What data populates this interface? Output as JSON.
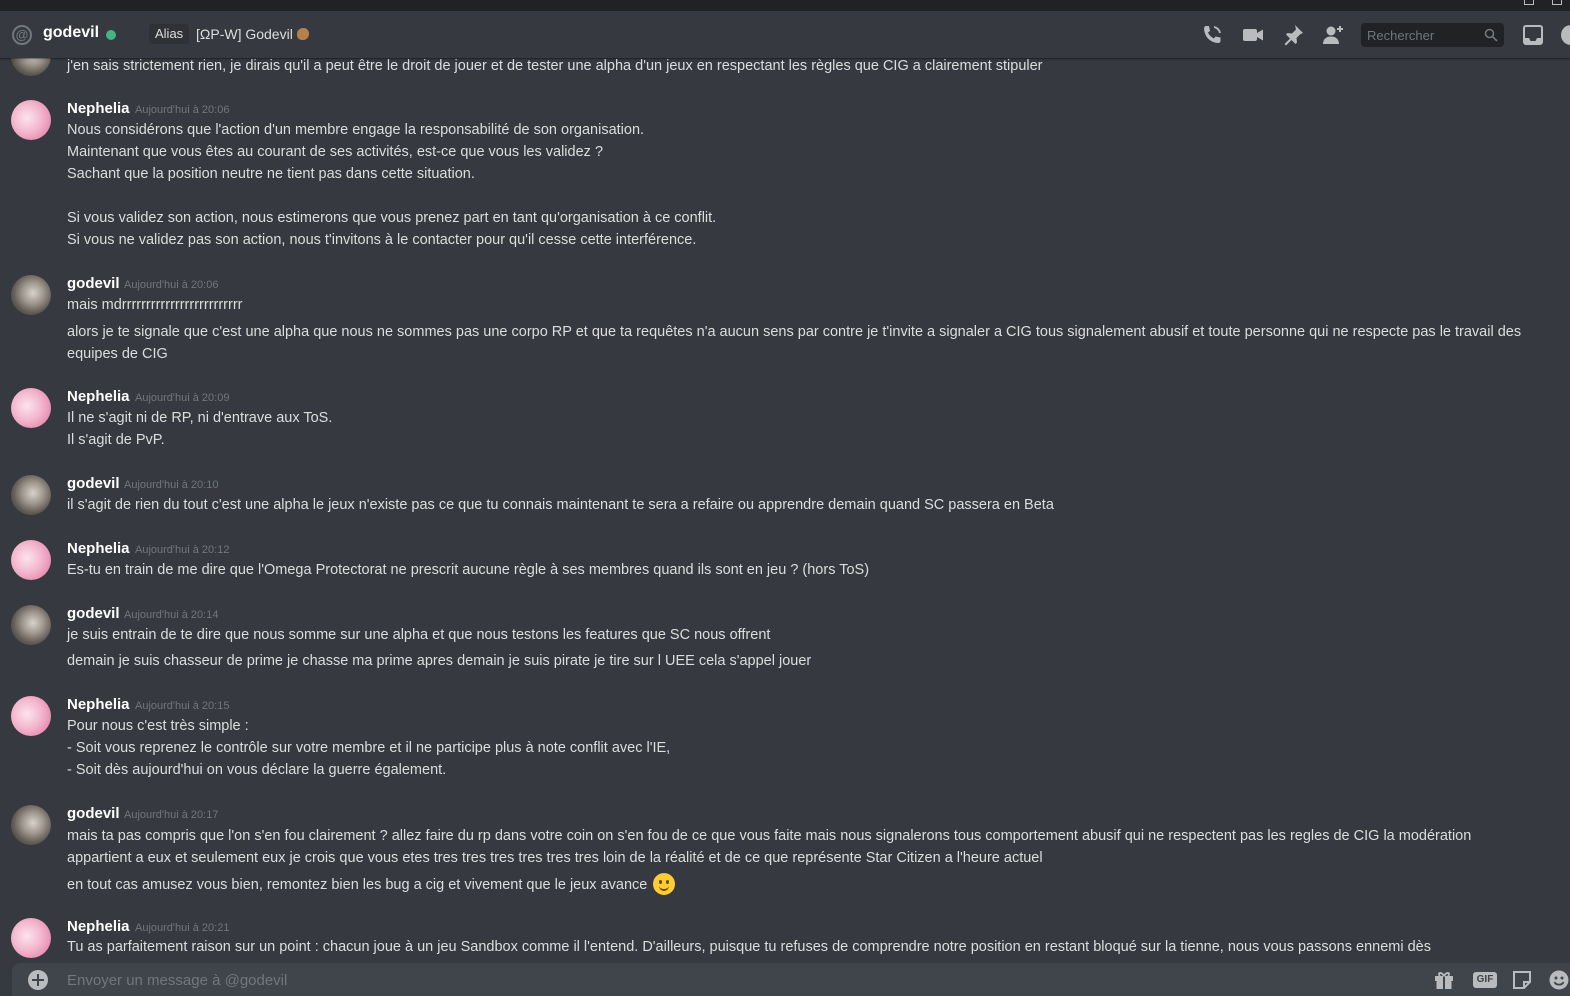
{
  "header": {
    "name": "godevil",
    "alias_label": "Alias",
    "alias_value": "[ΩP-W] Godevil",
    "search_placeholder": "Rechercher"
  },
  "messages": [
    {
      "author": "godevil",
      "time": "",
      "lines": [
        "j'en sais strictement rien, je dirais qu'il a peut être le droit de jouer et de tester une alpha d'un jeux en respectant les règles que CIG a clairement stipuler"
      ]
    },
    {
      "author": "Nephelia",
      "time": "Aujourd'hui à 20:06",
      "lines": [
        "Nous considérons que l'action d'un membre engage la responsabilité de son organisation.",
        "Maintenant que vous êtes au courant de ses activités, est-ce que vous les validez ?",
        "Sachant que la position neutre ne tient pas dans cette situation.",
        "Si vous validez son action, nous estimerons que vous prenez part en tant qu'organisation à ce conflit.",
        "Si vous ne validez pas son action, nous t'invitons à le contacter pour qu'il cesse cette interférence."
      ]
    },
    {
      "author": "godevil",
      "time": "Aujourd'hui à 20:06",
      "lines": [
        "mais mdrrrrrrrrrrrrrrrrrrrrrrrrr",
        "alors je te signale que c'est une alpha que nous ne sommes pas une corpo RP et que ta requêtes n'a aucun sens par contre je t'invite a signaler a CIG tous signalement abusif et toute personne qui ne respecte pas le travail des equipes de CIG"
      ]
    },
    {
      "author": "Nephelia",
      "time": "Aujourd'hui à 20:09",
      "lines": [
        "Il ne s'agit ni de RP, ni d'entrave aux ToS.",
        "Il s'agit de PvP."
      ]
    },
    {
      "author": "godevil",
      "time": "Aujourd'hui à 20:10",
      "lines": [
        "il s'agit de rien du tout c'est une alpha le jeux n'existe pas ce que tu connais maintenant te sera a refaire ou apprendre demain quand SC passera en Beta"
      ]
    },
    {
      "author": "Nephelia",
      "time": "Aujourd'hui à 20:12",
      "lines": [
        "Es-tu en train de me dire que l'Omega Protectorat ne prescrit aucune règle à ses membres quand ils sont en jeu ? (hors ToS)"
      ]
    },
    {
      "author": "godevil",
      "time": "Aujourd'hui à 20:14",
      "lines": [
        "je suis entrain de te dire que nous somme sur une alpha et que nous testons les features que SC nous offrent",
        "demain je suis chasseur de prime je chasse ma prime apres demain je suis pirate je tire sur l UEE cela s'appel jouer"
      ]
    },
    {
      "author": "Nephelia",
      "time": "Aujourd'hui à 20:15",
      "lines": [
        "Pour nous c'est très simple :",
        "- Soit vous reprenez le contrôle sur votre membre et il ne participe plus à note conflit avec l'IE,",
        "- Soit dès aujourd'hui on vous déclare la guerre également."
      ]
    },
    {
      "author": "godevil",
      "time": "Aujourd'hui à 20:17",
      "lines": [
        "mais ta pas compris que l'on s'en fou clairement ? allez faire du rp dans votre coin on s'en fou de ce que vous faite mais nous signalerons tous comportement abusif qui ne respectent pas les regles de CIG la modération appartient a eux et seulement eux je crois que vous etes tres tres tres tres tres tres loin de la réalité et de ce que représente Star Citizen a l'heure actuel",
        "en tout cas amusez vous bien, remontez bien les bug a cig et vivement que le jeux avance"
      ]
    },
    {
      "author": "Nephelia",
      "time": "Aujourd'hui à 20:21",
      "lines": [
        "Tu as parfaitement raison sur un point : chacun joue à un jeu Sandbox comme il l'entend. D'ailleurs, puisque tu refuses de comprendre notre position en restant bloqué sur la tienne, nous vous passons ennemi dès"
      ]
    }
  ],
  "composer": {
    "placeholder": "Envoyer un message à @godevil",
    "gif_label": "GIF"
  },
  "icons": [
    "at-icon",
    "call-icon",
    "video-icon",
    "pin-icon",
    "add-friend-icon",
    "search-icon",
    "inbox-icon",
    "help-icon",
    "plus-icon",
    "gift-icon",
    "gif-icon",
    "sticker-icon",
    "emoji-icon"
  ],
  "colors": {
    "bg": "#36393f",
    "online": "#43b581",
    "text": "#dcddde",
    "muted": "#72767d"
  }
}
